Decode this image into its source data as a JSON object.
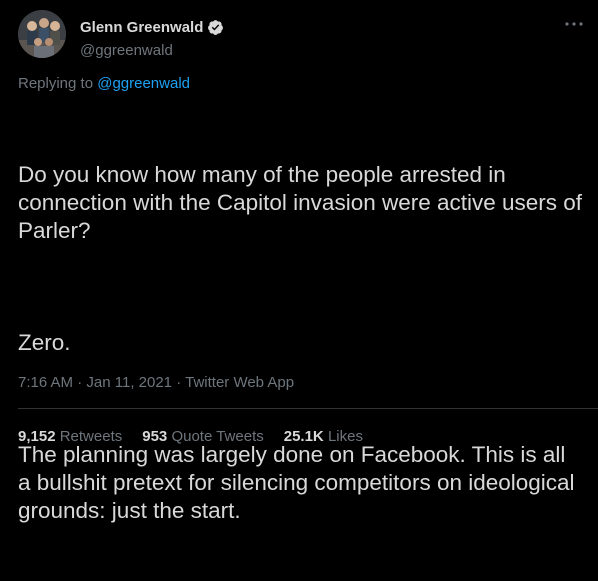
{
  "author": {
    "display_name": "Glenn Greenwald",
    "handle": "@ggreenwald",
    "verified": true
  },
  "reply": {
    "prefix": "Replying to",
    "handle": "@ggreenwald"
  },
  "tweet": {
    "paragraphs": [
      "Do you know how many of the people arrested in connection with the Capitol invasion were active users of Parler?",
      "Zero.",
      "The planning was largely done on Facebook. This is all a bullshit pretext for silencing competitors on ideological grounds: just the start."
    ],
    "time": "7:16 AM",
    "date": "Jan 11, 2021",
    "source": "Twitter Web App"
  },
  "stats": {
    "retweets_count": "9,152",
    "retweets_label": "Retweets",
    "quotes_count": "953",
    "quotes_label": "Quote Tweets",
    "likes_count": "25.1K",
    "likes_label": "Likes"
  },
  "colors": {
    "background": "#000000",
    "text": "#d9d9d9",
    "muted": "#6e767d",
    "accent": "#1da1f2"
  },
  "icons": {
    "verified": "verified-badge-icon",
    "more": "more-options-icon"
  }
}
